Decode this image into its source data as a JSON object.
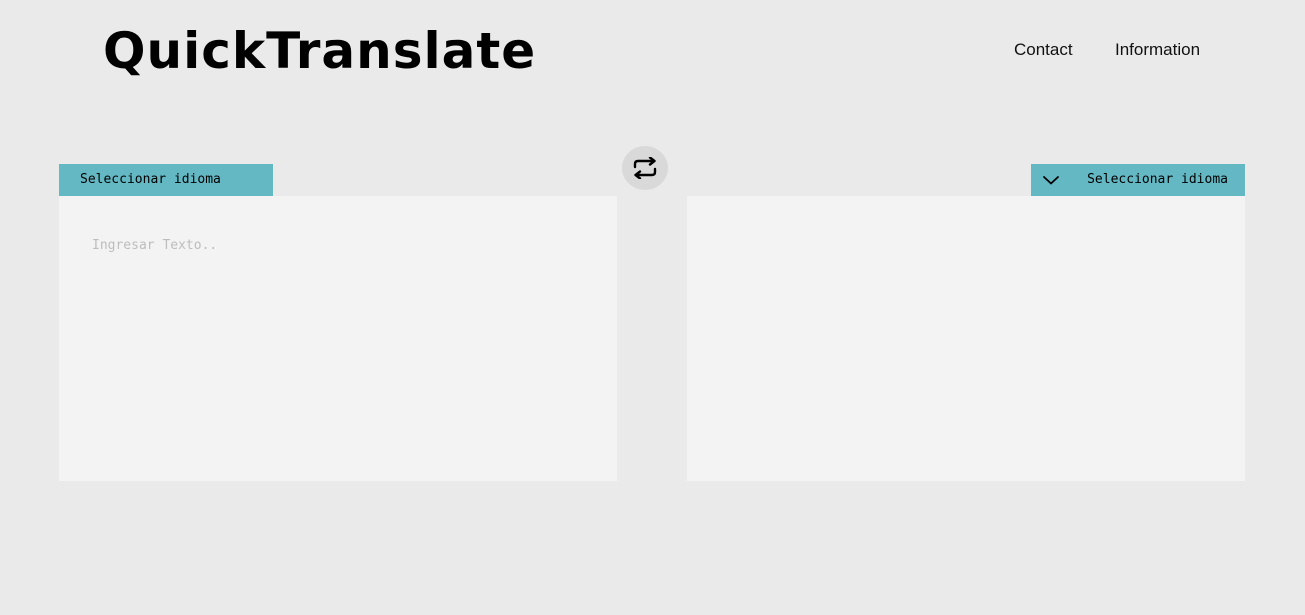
{
  "header": {
    "logo": "QuickTranslate",
    "nav": [
      {
        "label": "Contact"
      },
      {
        "label": "Information"
      }
    ]
  },
  "translator": {
    "source_language": {
      "label": "Seleccionar idioma"
    },
    "target_language": {
      "label": "Seleccionar idioma",
      "icon": "chevron-down-icon"
    },
    "swap_button": {
      "icon": "swap-arrows-icon"
    },
    "source_input": {
      "value": "",
      "placeholder": "Ingresar Texto.."
    },
    "output": {
      "value": ""
    }
  },
  "colors": {
    "background": "#eaeaea",
    "accent": "#64b8c4",
    "panel": "#f3f3f3",
    "swap_button": "#d9d9d9"
  }
}
